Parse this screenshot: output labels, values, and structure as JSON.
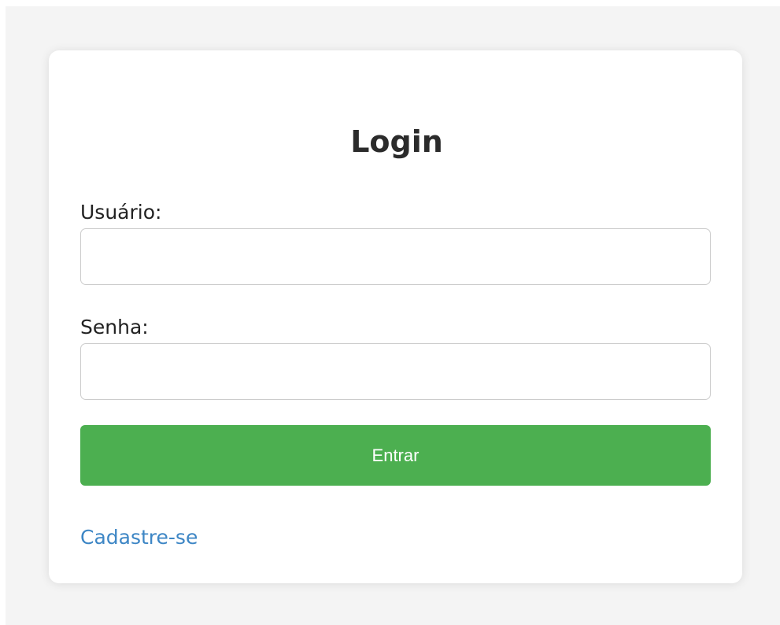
{
  "login_form": {
    "title": "Login",
    "username_label": "Usuário:",
    "username_value": "",
    "password_label": "Senha:",
    "password_value": "",
    "submit_label": "Entrar",
    "register_link": "Cadastre-se"
  },
  "colors": {
    "background": "#f4f4f4",
    "card": "#ffffff",
    "button": "#4caf50",
    "link": "#3d86c5"
  }
}
